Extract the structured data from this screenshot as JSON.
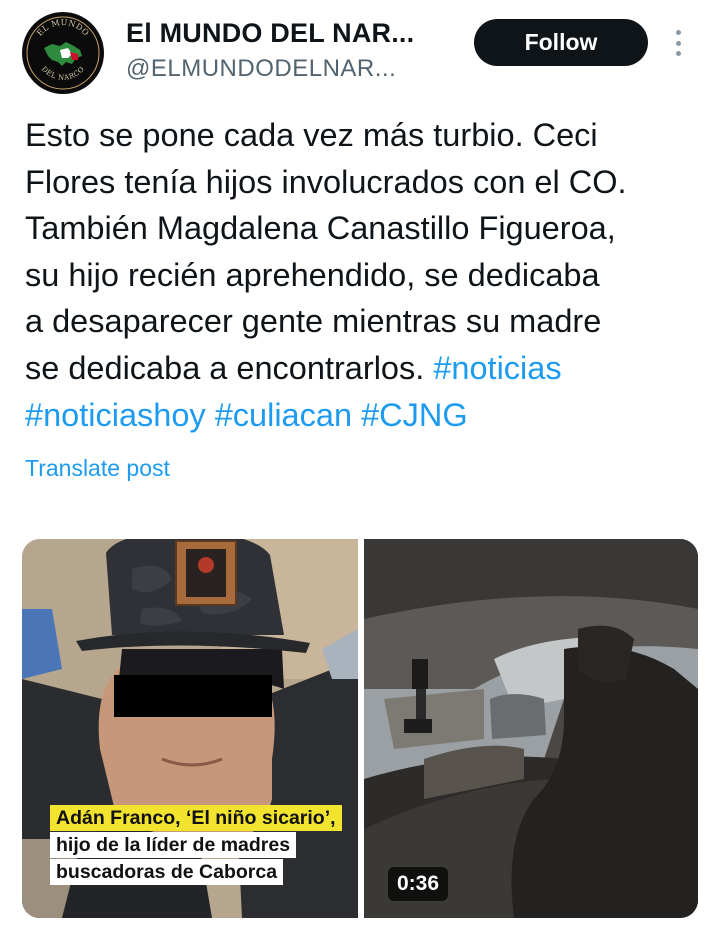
{
  "account": {
    "display_name": "El MUNDO DEL NAR...",
    "handle": "@ELMUNDODELNAR...",
    "avatar_icon": "el-mundo-del-narco-logo",
    "avatar_text_top": "EL MUNDO",
    "avatar_text_bottom": "DEL NARCO"
  },
  "actions": {
    "follow_label": "Follow",
    "more_icon": "more-vertical-icon"
  },
  "post": {
    "text_lines": [
      "Esto se pone cada vez más turbio. Ceci",
      "Flores tenía hijos involucrados con el CO.",
      "También Magdalena Canastillo Figueroa,",
      "su hijo recién aprehendido, se dedicaba",
      "a desaparecer gente mientras su madre",
      "se dedicaba a encontrarlos. "
    ],
    "hashtags": [
      "#noticias",
      "#noticiashoy",
      "#culiacan",
      "#CJNG"
    ],
    "translate_label": "Translate post"
  },
  "media": {
    "left_caption": {
      "line1": "Adán Franco, ‘El niño sicario’,",
      "line2": "hijo de la líder de madres",
      "line3": "buscadoras de Caborca"
    },
    "video_duration": "0:36"
  },
  "colors": {
    "link": "#1d9bf0",
    "text": "#0f1419",
    "secondary": "#536471",
    "follow_bg": "#0f1419",
    "caption_highlight": "#f1e32e"
  }
}
